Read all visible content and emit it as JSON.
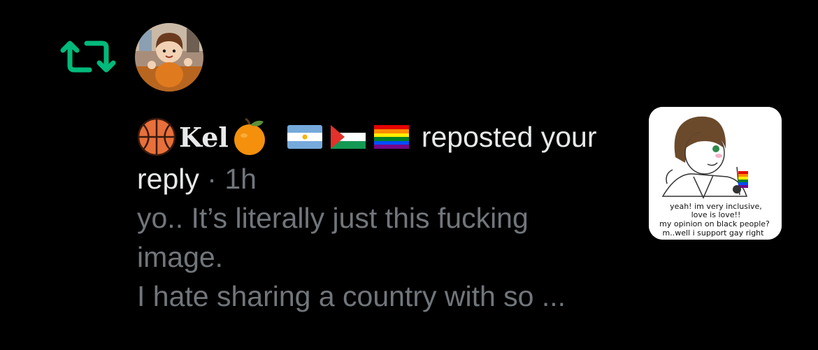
{
  "notification": {
    "icon": "repost-icon",
    "accent_color": "#00ba7c",
    "user": {
      "avatar": "user-avatar",
      "prefix_emoji": "basketball-emoji",
      "display_name": "Kel",
      "suffix_emoji": "tangerine-emoji",
      "flags": [
        "argentina-flag",
        "palestine-flag",
        "rainbow-flag"
      ]
    },
    "action_text": "reposted your",
    "action_text_cont": "reply",
    "separator": " · ",
    "time": "1h",
    "snippet_lines": [
      "yo.. It’s literally just this fucking",
      "image.",
      "I hate sharing a country with so ..."
    ],
    "thumbnail": {
      "caption_lines": [
        "yeah! im very inclusive,",
        "love is love!!",
        "my opinion on black people?",
        "m..well i support gay right"
      ]
    }
  }
}
